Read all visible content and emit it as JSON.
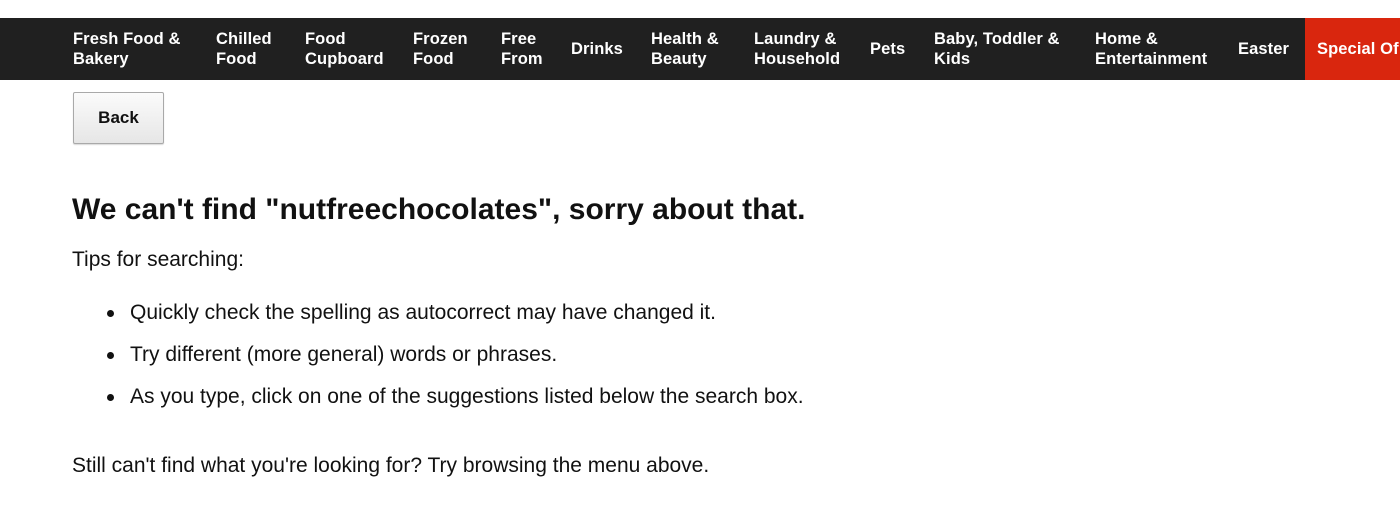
{
  "nav": {
    "items": [
      {
        "label": "Fresh Food &\nBakery"
      },
      {
        "label": "Chilled\nFood"
      },
      {
        "label": "Food\nCupboard"
      },
      {
        "label": "Frozen\nFood"
      },
      {
        "label": "Free\nFrom"
      },
      {
        "label": "Drinks"
      },
      {
        "label": "Health &\nBeauty"
      },
      {
        "label": "Laundry &\nHousehold"
      },
      {
        "label": "Pets"
      },
      {
        "label": "Baby, Toddler &\nKids"
      },
      {
        "label": "Home &\nEntertainment"
      },
      {
        "label": "Easter"
      },
      {
        "label": "Special Of"
      }
    ],
    "bar_color": "#202020",
    "special_color": "#d9260e"
  },
  "back_button": {
    "label": "Back"
  },
  "main": {
    "heading": "We can't find \"nutfreechocolates\", sorry about that.",
    "tips_title": "Tips for searching:",
    "tips": [
      "Quickly check the spelling as autocorrect may have changed it.",
      "Try different (more general) words or phrases.",
      "As you type, click on one of the suggestions listed below the search box."
    ],
    "still_text": "Still can't find what you're looking for? Try browsing the menu above."
  }
}
